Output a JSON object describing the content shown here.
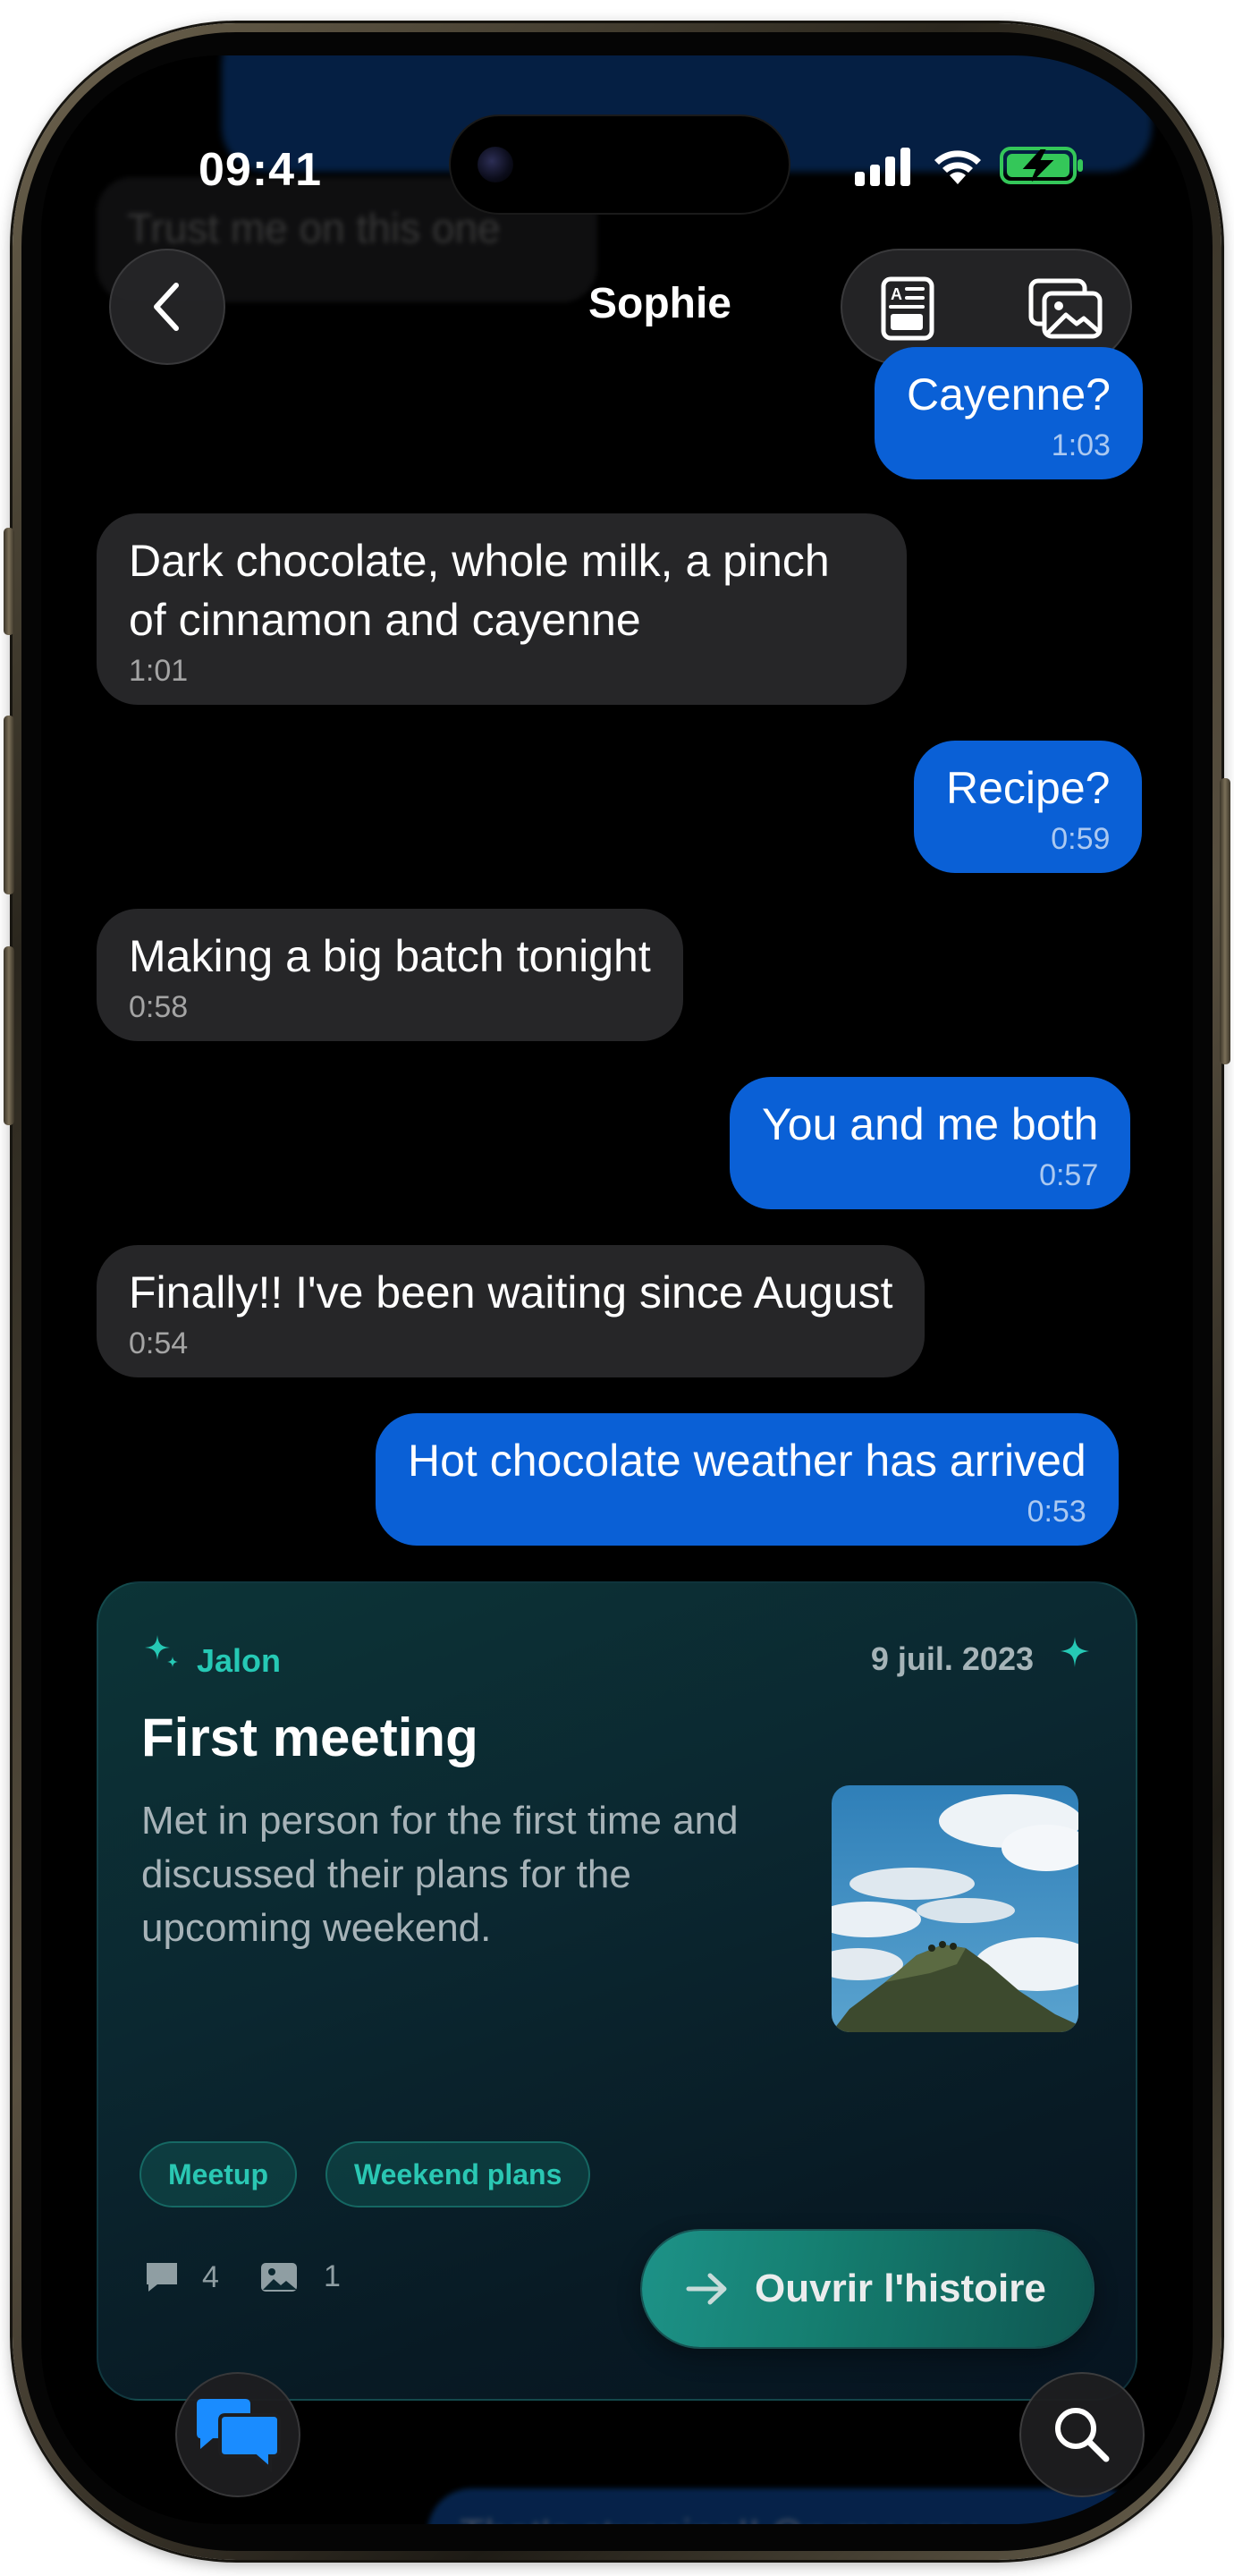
{
  "status_bar": {
    "time": "09:41",
    "icons": [
      "cellular-signal-icon",
      "wifi-icon",
      "battery-charging-icon"
    ],
    "battery_color": "#34c759"
  },
  "header": {
    "title": "Sophie",
    "back_icon": "chevron-left-icon",
    "actions": [
      "document-icon",
      "photo-gallery-icon"
    ]
  },
  "scrolled_hint": {
    "top_text": "Trust me on this one",
    "bottom_text": "That's stunning!! On my way"
  },
  "messages": [
    {
      "direction": "out",
      "text": "Cayenne?",
      "time": "1:03"
    },
    {
      "direction": "in",
      "text": "Dark chocolate, whole milk, a pinch of cinnamon and cayenne",
      "time": "1:01"
    },
    {
      "direction": "out",
      "text": "Recipe?",
      "time": "0:59"
    },
    {
      "direction": "in",
      "text": "Making a big batch tonight",
      "time": "0:58"
    },
    {
      "direction": "out",
      "text": "You and me both",
      "time": "0:57"
    },
    {
      "direction": "in",
      "text": "Finally!! I've been waiting since August",
      "time": "0:54"
    },
    {
      "direction": "out",
      "text": "Hot chocolate weather has arrived",
      "time": "0:53"
    }
  ],
  "milestone_card": {
    "label": "Jalon",
    "date": "9 juil. 2023",
    "title": "First meeting",
    "description": "Met in person for the first time and discussed their plans for the upcoming weekend.",
    "tags": [
      "Meetup",
      "Weekend plans"
    ],
    "comment_count": "4",
    "photo_count": "1",
    "open_button_label": "Ouvrir l'histoire",
    "accent_color": "#26c9b5"
  },
  "colors": {
    "outgoing_bubble": "#0a60d6",
    "incoming_bubble": "#262628",
    "background": "#000000"
  }
}
